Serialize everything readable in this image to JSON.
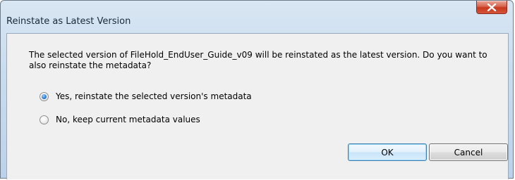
{
  "window": {
    "title": "Reinstate as Latest Version",
    "close_glyph": "X"
  },
  "dialog": {
    "message": "The selected version of FileHold_EndUser_Guide_v09 will be reinstated as the latest version. Do you want to also reinstate the metadata?",
    "options": [
      {
        "label": "Yes, reinstate the selected version's metadata",
        "selected": true
      },
      {
        "label": "No, keep current metadata values",
        "selected": false
      }
    ],
    "ok_label": "OK",
    "cancel_label": "Cancel"
  },
  "colors": {
    "frame": "#c9dcef",
    "close_button": "#c8381d",
    "client_bg": "#f0f0f0",
    "ok_border": "#3c7fb1"
  }
}
